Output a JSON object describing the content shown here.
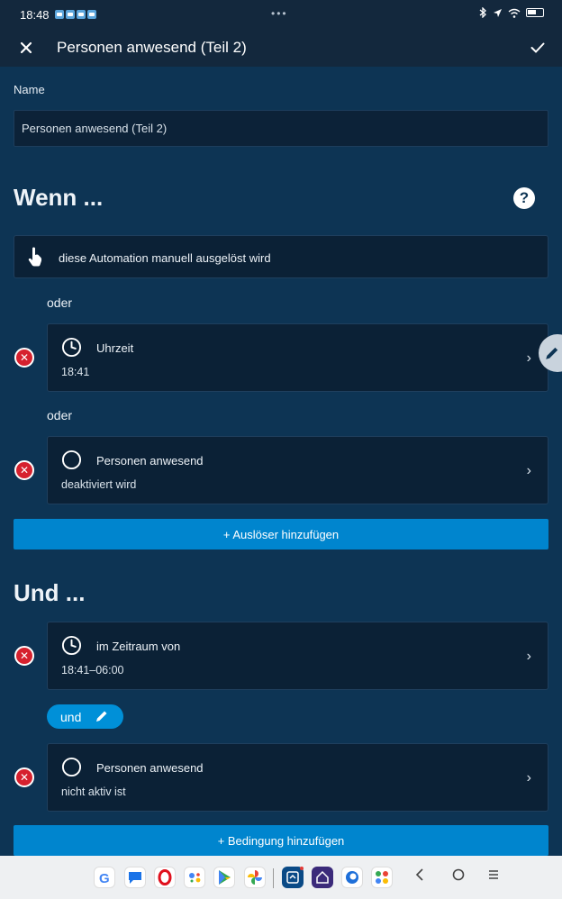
{
  "status_bar": {
    "time": "18:48",
    "dots": "•••"
  },
  "app_bar": {
    "title": "Personen anwesend (Teil 2)"
  },
  "name_field": {
    "label": "Name",
    "value": "Personen anwesend (Teil 2)"
  },
  "when_section": {
    "title": "Wenn ...",
    "manual_trigger": "diese Automation manuell ausgelöst wird",
    "or_label": "oder",
    "triggers": [
      {
        "title": "Uhrzeit",
        "detail": "18:41",
        "icon": "clock-icon"
      },
      {
        "title": "Personen anwesend",
        "detail": "deaktiviert wird",
        "icon": "circle-icon"
      }
    ],
    "add_button": "+ Auslöser hinzufügen"
  },
  "and_section": {
    "title": "Und ...",
    "conditions": [
      {
        "title": "im Zeitraum von",
        "detail": "18:41–06:00",
        "icon": "clock-icon"
      },
      {
        "title": "Personen anwesend",
        "detail": "nicht aktiv ist",
        "icon": "circle-icon"
      }
    ],
    "logic_pill": "und",
    "add_button": "+ Bedingung hinzufügen"
  },
  "colors": {
    "background": "#0d3454",
    "app_bar": "#13283d",
    "card": "#0b2136",
    "accent": "#0085ce",
    "remove": "#d6212e"
  },
  "taskbar": {
    "apps": [
      "google-icon",
      "messages-icon",
      "opera-icon",
      "assistant-icon",
      "play-store-icon",
      "photos-icon",
      "smart-home-icon",
      "home-connect-icon",
      "firefox-icon",
      "app-drawer-icon"
    ]
  }
}
